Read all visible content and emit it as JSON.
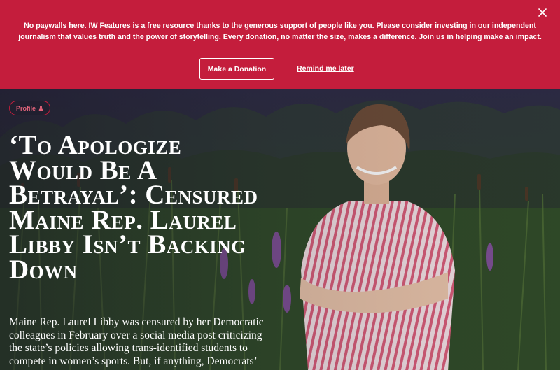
{
  "banner": {
    "message": "No paywalls here. IW Features is a free resource thanks to the generous support of people like you. Please consider investing in our independent journalism that values truth and the power of storytelling. Every donation, no matter the size, makes a difference. Join us in helping make an impact.",
    "donate_label": "Make a Donation",
    "remind_label": "Remind me later",
    "close_icon": "close-icon",
    "background_color": "#c41d3c"
  },
  "article": {
    "category_label": "Profile",
    "category_icon": "person-icon",
    "headline": "‘To Apologize Would Be A Betrayal’: Censured Maine Rep. Laurel Libby Isn’t Backing Down",
    "dek": "Maine Rep. Laurel Libby was censured by her Democratic colleagues in February over a social media post criticizing the state’s policies allowing trans-identified students to compete in women’s sports. But, if anything, Democrats’",
    "accent_color": "#c41d3c"
  }
}
